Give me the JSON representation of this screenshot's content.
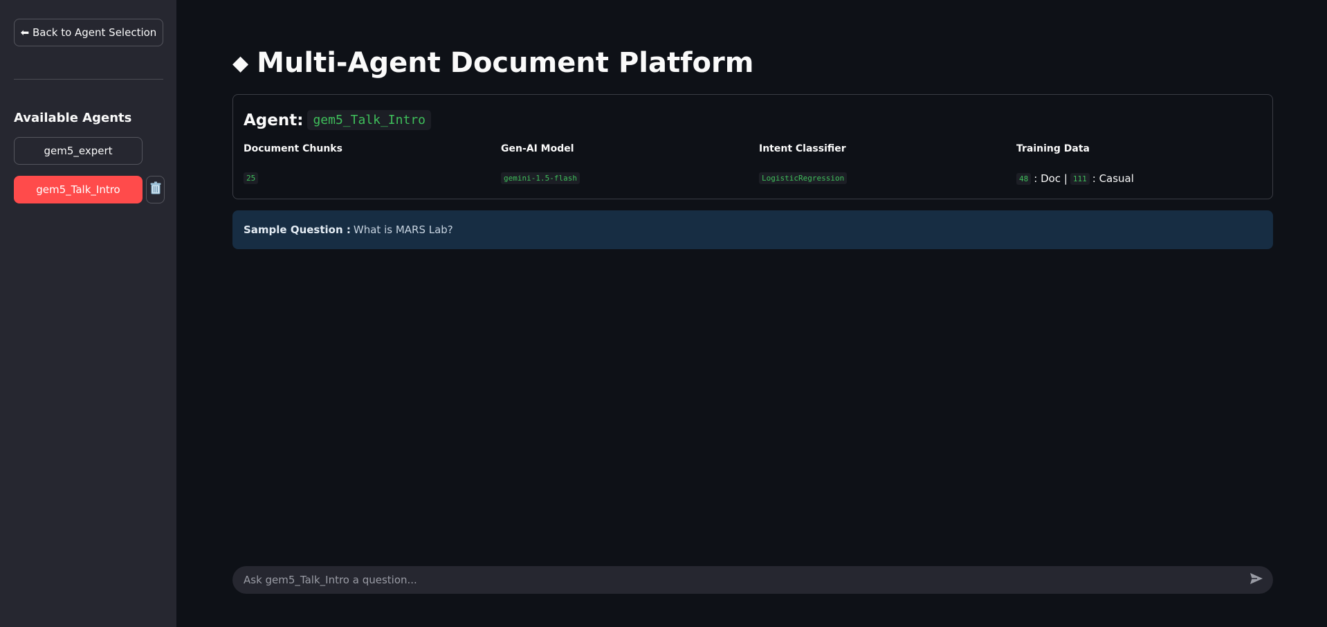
{
  "sidebar": {
    "back_label": "⬅ Back to Agent Selection",
    "heading": "Available Agents",
    "agents": [
      {
        "label": "gem5_expert",
        "active": false
      },
      {
        "label": "gem5_Talk_Intro",
        "active": true
      }
    ],
    "delete_icon": "trash-icon"
  },
  "main": {
    "title_icon": "◆",
    "title": "Multi-Agent Document Platform",
    "agent_label": "Agent:",
    "agent_name": "gem5_Talk_Intro",
    "stats": [
      {
        "label": "Document Chunks",
        "value": "25"
      },
      {
        "label": "Gen-AI Model",
        "value": "gemini-1.5-flash"
      },
      {
        "label": "Intent Classifier",
        "value": "LogisticRegression"
      },
      {
        "label": "Training Data",
        "doc_count": "48",
        "doc_text": ": Doc |",
        "casual_count": "111",
        "casual_text": ": Casual"
      }
    ],
    "sample": {
      "label": "Sample Question :",
      "question": "What is MARS Lab?"
    },
    "chat": {
      "placeholder": "Ask gem5_Talk_Intro a question...",
      "send_icon": "send-icon"
    }
  },
  "colors": {
    "background": "#0e1117",
    "sidebar": "#262730",
    "accent": "#ff4b4b",
    "code_green": "#3fbf5b",
    "info_box": "#172d43"
  }
}
